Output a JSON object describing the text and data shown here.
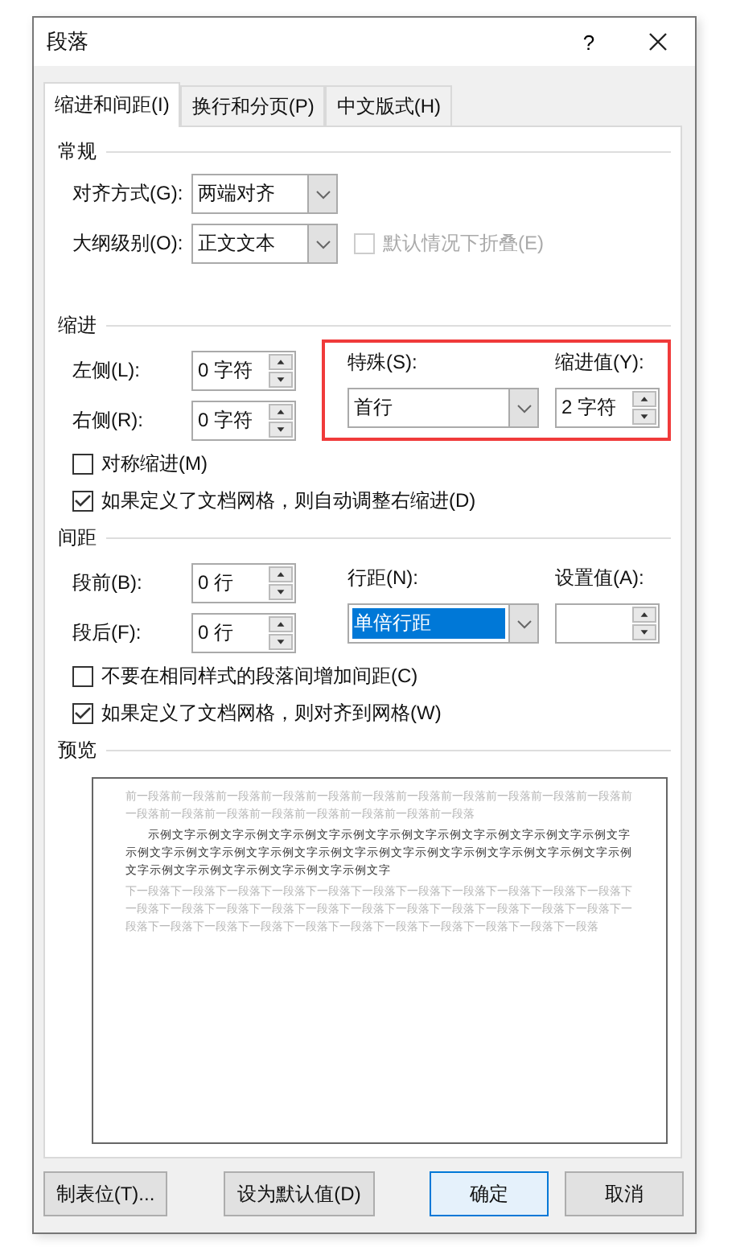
{
  "window": {
    "title": "段落",
    "help": "?"
  },
  "tabs": [
    {
      "label": "缩进和间距(I)",
      "selected": true
    },
    {
      "label": "换行和分页(P)",
      "selected": false
    },
    {
      "label": "中文版式(H)",
      "selected": false
    }
  ],
  "general": {
    "heading": "常规",
    "alignment": {
      "label": "对齐方式(G):",
      "value": "两端对齐"
    },
    "outline": {
      "label": "大纲级别(O):",
      "value": "正文文本"
    },
    "collapse": {
      "label": "默认情况下折叠(E)",
      "checked": false,
      "disabled": true
    }
  },
  "indent": {
    "heading": "缩进",
    "left": {
      "label": "左侧(L):",
      "value": "0 字符"
    },
    "right": {
      "label": "右侧(R):",
      "value": "0 字符"
    },
    "special": {
      "label": "特殊(S):",
      "value": "首行"
    },
    "by": {
      "label": "缩进值(Y):",
      "value": "2 字符"
    },
    "highlighted": true,
    "checks": [
      {
        "label": "对称缩进(M)",
        "checked": false
      },
      {
        "label": "如果定义了文档网格，则自动调整右缩进(D)",
        "checked": true
      }
    ]
  },
  "spacing": {
    "heading": "间距",
    "before": {
      "label": "段前(B):",
      "value": "0 行"
    },
    "after": {
      "label": "段后(F):",
      "value": "0 行"
    },
    "line": {
      "label": "行距(N):",
      "value": "单倍行距",
      "selected": true
    },
    "at": {
      "label": "设置值(A):"
    },
    "checks": [
      {
        "label": "不要在相同样式的段落间增加间距(C)",
        "checked": false
      },
      {
        "label": "如果定义了文档网格，则对齐到网格(W)",
        "checked": true
      }
    ]
  },
  "preview": {
    "heading": "预览",
    "previous": "前一段落前一段落前一段落前一段落前一段落前一段落前一段落前一段落前一段落前一段落前一段落前一段落前一段落前一段落前一段落前一段落前一段落前一段落前一段落",
    "sample": "示例文字示例文字示例文字示例文字示例文字示例文字示例文字示例文字示例文字示例文字示例文字示例文字示例文字示例文字示例文字示例文字示例文字示例文字示例文字示例文字示例文字示例文字示例文字示例文字示例文字示例文字",
    "next": "下一段落下一段落下一段落下一段落下一段落下一段落下一段落下一段落下一段落下一段落下一段落下一段落下一段落下一段落下一段落下一段落下一段落下一段落下一段落下一段落下一段落下一段落下一段落下一段落下一段落下一段落下一段落下一段落下一段落下一段落下一段落下一段落下一段落"
  },
  "buttons": [
    {
      "label": "制表位(T)...",
      "kind": "normal"
    },
    {
      "label": "设为默认值(D)",
      "kind": "normal"
    },
    {
      "label": "确定",
      "kind": "default"
    },
    {
      "label": "取消",
      "kind": "normal"
    }
  ]
}
